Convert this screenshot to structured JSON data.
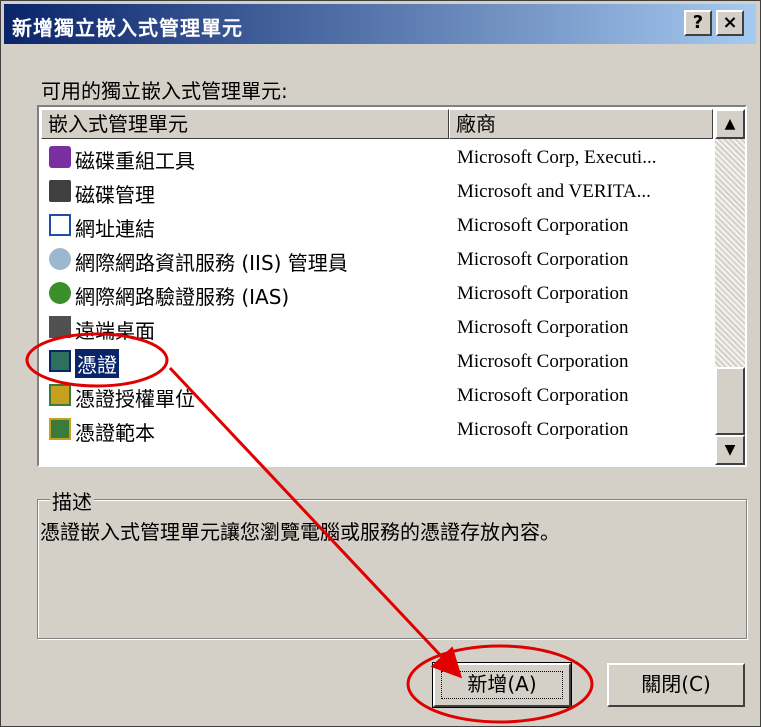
{
  "dialog": {
    "title": "新增獨立嵌入式管理單元",
    "help_label": "?",
    "close_label": "×"
  },
  "available_label": "可用的獨立嵌入式管理單元:",
  "list": {
    "columns": [
      "嵌入式管理單元",
      "廠商"
    ],
    "rows": [
      {
        "name": "磁碟重組工具",
        "vendor": "Microsoft Corp, Executi...",
        "icon": "defrag-icon",
        "color": "#7a2fa0"
      },
      {
        "name": "磁碟管理",
        "vendor": "Microsoft and VERITA...",
        "icon": "disk-management-icon",
        "color": "#404040"
      },
      {
        "name": "網址連結",
        "vendor": "Microsoft Corporation",
        "icon": "link-icon",
        "color": "#1e4fa8"
      },
      {
        "name": "網際網路資訊服務 (IIS) 管理員",
        "vendor": "Microsoft Corporation",
        "icon": "iis-icon",
        "color": "#2a7fbf"
      },
      {
        "name": "網際網路驗證服務 (IAS)",
        "vendor": "Microsoft Corporation",
        "icon": "ias-icon",
        "color": "#3a8f2a"
      },
      {
        "name": "遠端桌面",
        "vendor": "Microsoft Corporation",
        "icon": "remote-desktop-icon",
        "color": "#505050"
      },
      {
        "name": "憑證",
        "vendor": "Microsoft Corporation",
        "icon": "certificates-icon",
        "color": "#2f6f5f"
      },
      {
        "name": "憑證授權單位",
        "vendor": "Microsoft Corporation",
        "icon": "certificate-authority-icon",
        "color": "#c8a020"
      },
      {
        "name": "憑證範本",
        "vendor": "Microsoft Corporation",
        "icon": "certificate-templates-icon",
        "color": "#3a7a3a"
      }
    ],
    "selected_index": 6
  },
  "description": {
    "title": "描述",
    "text": "憑證嵌入式管理單元讓您瀏覽電腦或服務的憑證存放內容。"
  },
  "buttons": {
    "add": "新增(A)",
    "close": "關閉(C)"
  },
  "annotation": {
    "color": "#e00000"
  }
}
